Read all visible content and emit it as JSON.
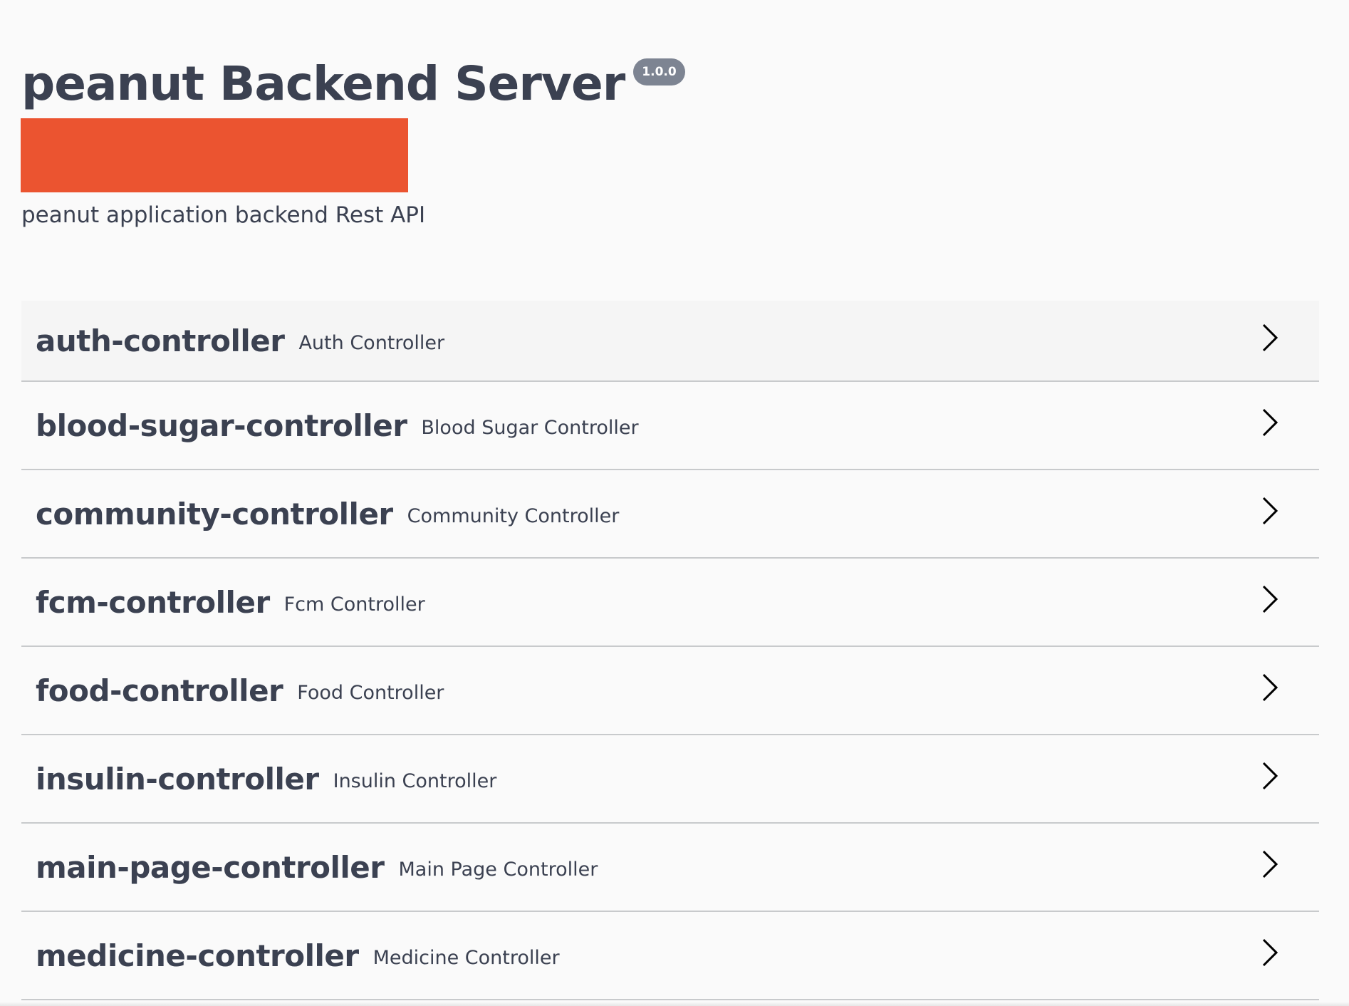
{
  "header": {
    "title": "peanut Backend Server",
    "version": "1.0.0",
    "description": "peanut application backend Rest API",
    "redaction_color": "#eb5430"
  },
  "colors": {
    "text": "#3b4151",
    "badge": "#7d8492",
    "background": "#fafafa",
    "divider": "#c8cacc"
  },
  "tags": [
    {
      "name": "auth-controller",
      "description": "Auth Controller",
      "icon": "chevron-right-icon"
    },
    {
      "name": "blood-sugar-controller",
      "description": "Blood Sugar Controller",
      "icon": "chevron-right-icon"
    },
    {
      "name": "community-controller",
      "description": "Community Controller",
      "icon": "chevron-right-icon"
    },
    {
      "name": "fcm-controller",
      "description": "Fcm Controller",
      "icon": "chevron-right-icon"
    },
    {
      "name": "food-controller",
      "description": "Food Controller",
      "icon": "chevron-right-icon"
    },
    {
      "name": "insulin-controller",
      "description": "Insulin Controller",
      "icon": "chevron-right-icon"
    },
    {
      "name": "main-page-controller",
      "description": "Main Page Controller",
      "icon": "chevron-right-icon"
    },
    {
      "name": "medicine-controller",
      "description": "Medicine Controller",
      "icon": "chevron-right-icon"
    }
  ]
}
